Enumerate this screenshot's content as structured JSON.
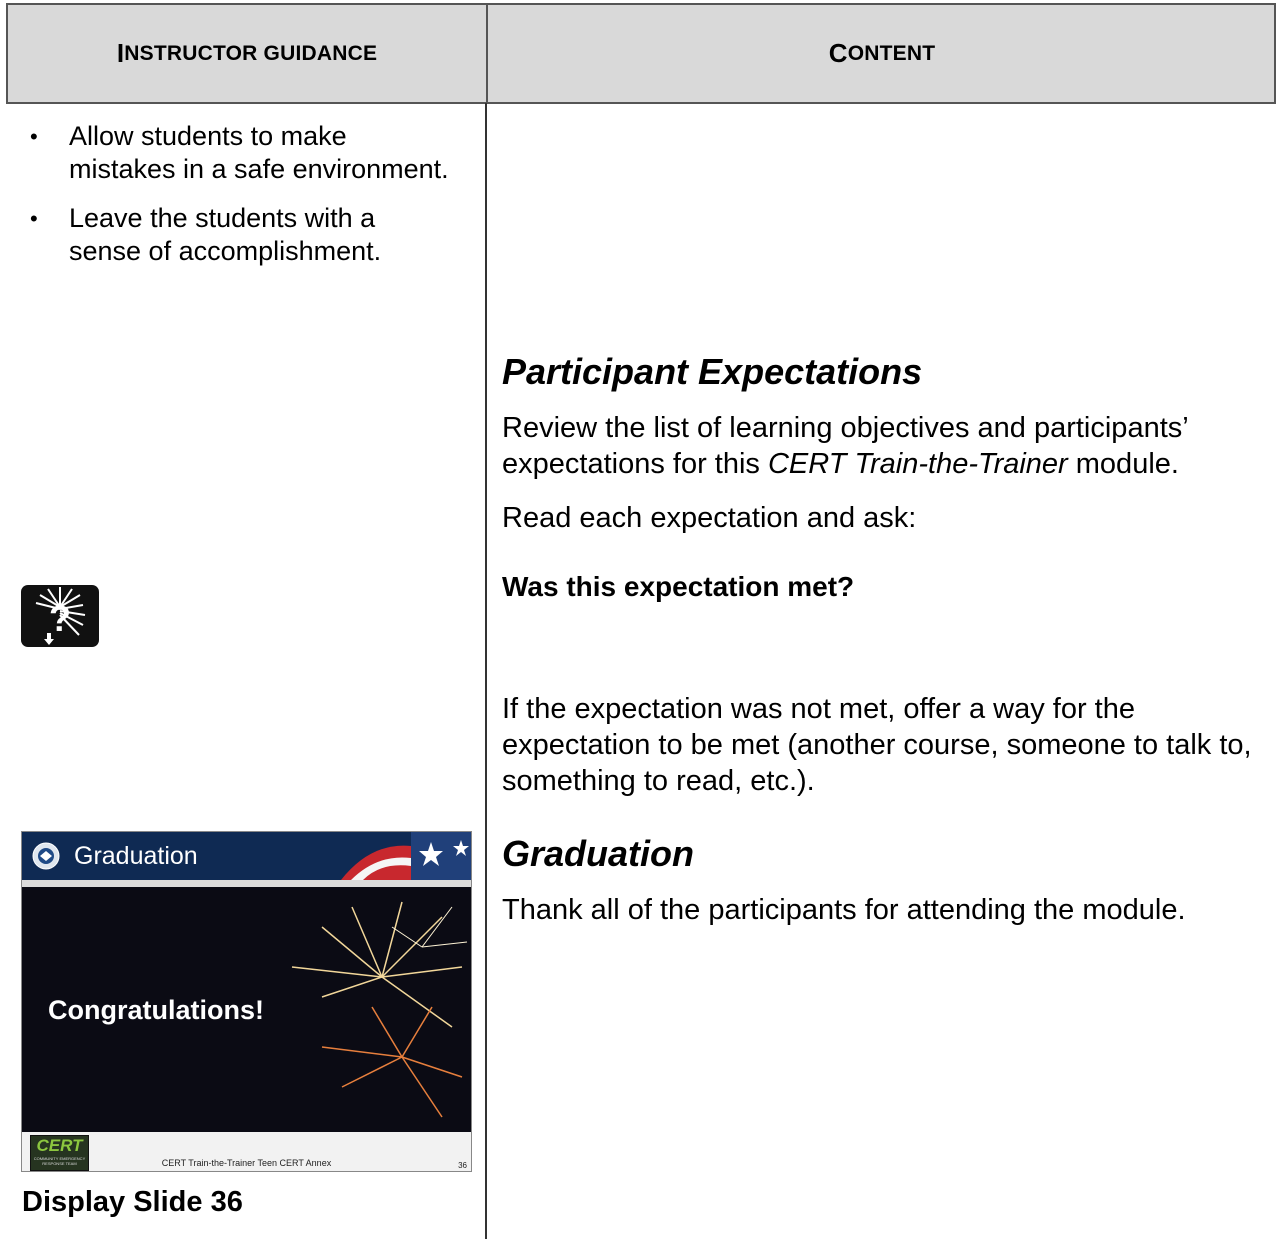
{
  "header": {
    "left_first": "I",
    "left_rest": "nstructor guidance",
    "right_first": "C",
    "right_rest": "ontent"
  },
  "guidance": {
    "bullets": [
      "Allow students to make mistakes in a safe environment.",
      "Leave the students with a sense of accomplishment."
    ],
    "bullet_glyph": "•"
  },
  "content": {
    "participant_heading": "Participant Expectations",
    "review_pre": "Review the list of learning objectives and participants’ expectations for this ",
    "review_italic": "CERT Train-the-Trainer",
    "review_post": " module.",
    "read_each": "Read each expectation and ask:",
    "question": "Was this expectation met?",
    "if_not_met": "If the expectation was not met, offer a way for the expectation to be met (another course, someone to talk to, something to read, etc.).",
    "graduation_heading": "Graduation",
    "thank": "Thank all of the participants for attending the module."
  },
  "slide": {
    "title": "Graduation",
    "congrats": "Congratulations!",
    "logo_text": "CERT",
    "logo_subtext": "COMMUNITY EMERGENCY RESPONSE TEAM",
    "footer": "CERT Train-the-Trainer Teen CERT Annex",
    "number": "36"
  },
  "display_caption": "Display Slide 36",
  "icons": {
    "question_icon": "question-burst-icon",
    "seal_icon": "dhs-seal-icon",
    "flag_icon": "flag-stars-icon"
  }
}
